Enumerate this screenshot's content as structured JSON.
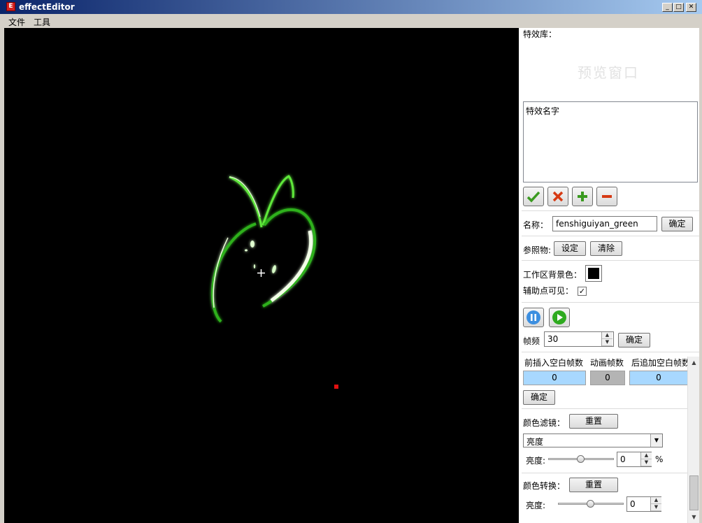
{
  "window": {
    "title": "effectEditor",
    "icon_letter": "E",
    "min_symbol": "_",
    "max_symbol": "□",
    "close_symbol": "✕"
  },
  "menu": {
    "file": "文件",
    "tools": "工具"
  },
  "canvas": {
    "background_color": "#000000"
  },
  "panel": {
    "library_label": "特效库：",
    "preview_text": "预览窗口",
    "list_item": "特效名字",
    "action_icons": [
      "check-icon",
      "delete-icon",
      "add-icon",
      "remove-icon"
    ],
    "name_label": "名称：",
    "name_value": "fenshiguiyan_green",
    "name_confirm": "确定",
    "reference_label": "参照物:",
    "reference_set": "设定",
    "reference_clear": "清除",
    "bg_color_label": "工作区背景色：",
    "bg_color_value": "#000000",
    "helper_visible_label": "辅助点可见：",
    "helper_visible_check": "✓",
    "fps_label": "帧频",
    "fps_value": "30",
    "fps_confirm": "确定",
    "frames": {
      "pre_label": "前插入空白帧数",
      "anim_label": "动画帧数",
      "post_label": "后追加空白帧数",
      "pre_value": "0",
      "anim_value": "0",
      "post_value": "0",
      "confirm": "确定"
    },
    "color_filter": {
      "label": "颜色滤镜：",
      "reset": "重置",
      "selected": "亮度",
      "brightness_label": "亮度:",
      "brightness_value": "0",
      "unit": "%"
    },
    "color_transform": {
      "label": "颜色转换：",
      "reset": "重置",
      "brightness_label": "亮度:",
      "brightness_value": "0"
    }
  }
}
